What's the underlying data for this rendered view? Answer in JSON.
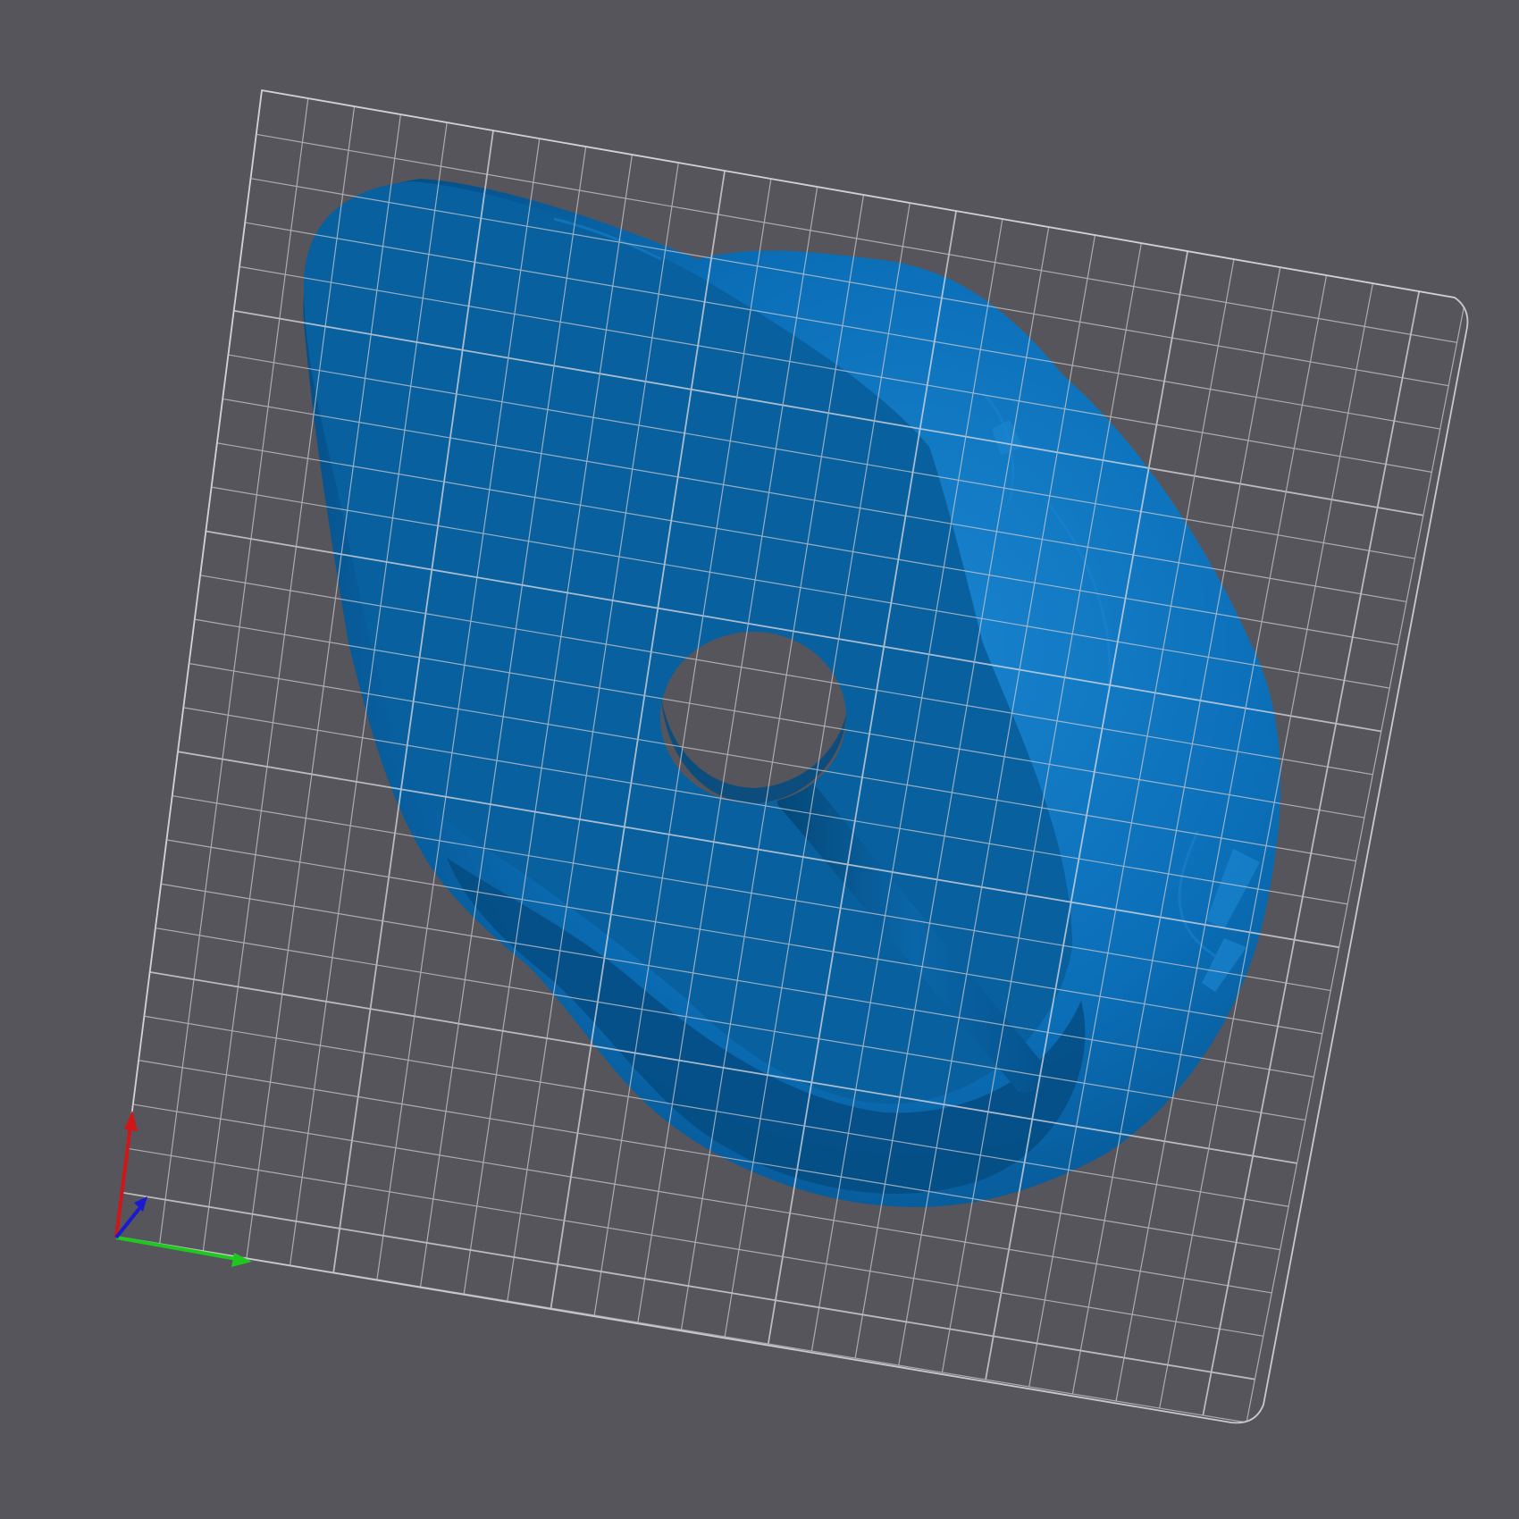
{
  "viewport": {
    "background": "#56555b",
    "view": "3d-print-preparation-viewport"
  },
  "build_plate": {
    "grid": true,
    "grid_color": "#c9c9cd",
    "major_line_color": "#dcdce0"
  },
  "model": {
    "color": "#0b6fb8",
    "top_face_color": "#08609f",
    "shadow_color": "#054c82",
    "highlight_color": "#1a84cf",
    "features": [
      "through-hole",
      "cylindrical-channel",
      "scanned-organic-surface"
    ]
  },
  "axes": {
    "x_color": "#1ec81e",
    "y_color": "#1a1ad0",
    "z_color": "#d01616"
  }
}
